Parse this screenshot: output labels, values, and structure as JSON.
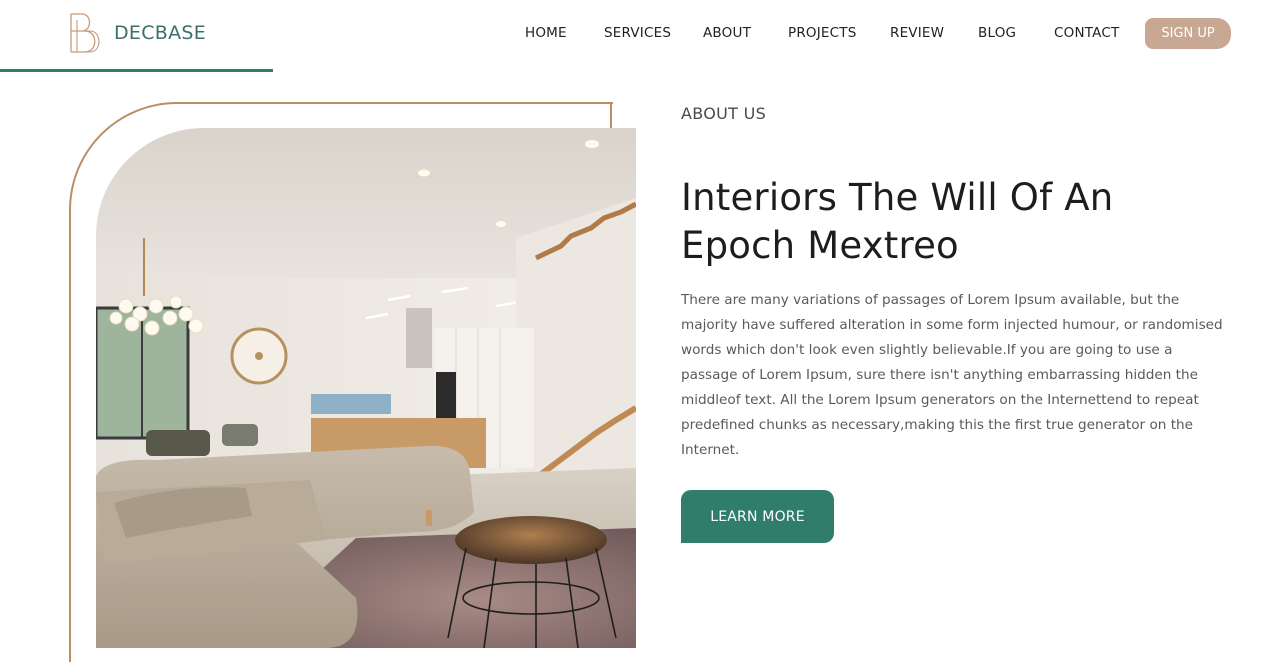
{
  "brand": {
    "name": "DECBASE",
    "logo_icon": "b-monogram-icon",
    "accent_color": "#2f7d6a",
    "secondary_color": "#c9a893"
  },
  "nav": {
    "items": [
      {
        "label": "HOME"
      },
      {
        "label": "SERVICES"
      },
      {
        "label": "ABOUT"
      },
      {
        "label": "PROJECTS"
      },
      {
        "label": "REVIEW"
      },
      {
        "label": "BLOG"
      },
      {
        "label": "CONTACT"
      }
    ],
    "signup_label": "SIGN UP"
  },
  "about": {
    "eyebrow": "ABOUT US",
    "title_line1": "Interiors The Will Of An",
    "title_line2": "Epoch Mextreo",
    "body": "There are many variations of passages of Lorem Ipsum available, but the majority have suffered alteration in some form injected humour, or randomised words which don't look even slightly believable.If you are going to use a passage of Lorem Ipsum, sure there isn't anything embarrassing hidden the middleof text. All the Lorem Ipsum generators on the Internettend to repeat predefined chunks as necessary,making this the first true generator on the Internet.",
    "cta_label": "LEARN MORE"
  },
  "hero_image": {
    "subject": "interior-living-room-photo"
  }
}
